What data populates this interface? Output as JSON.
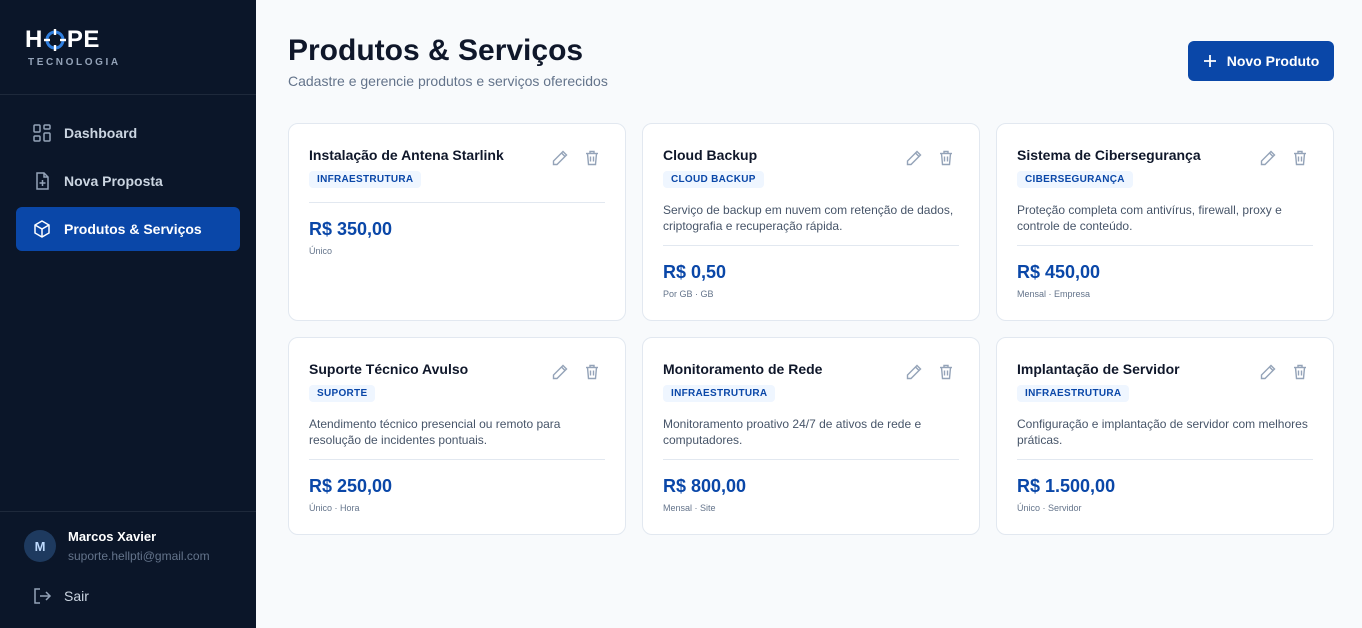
{
  "brand": {
    "name_left": "H",
    "name_right": "PE",
    "tagline": "TECNOLOGIA"
  },
  "nav": [
    {
      "label": "Dashboard",
      "icon": "grid-icon",
      "active": false
    },
    {
      "label": "Nova Proposta",
      "icon": "file-plus-icon",
      "active": false
    },
    {
      "label": "Produtos & Serviços",
      "icon": "box-icon",
      "active": true
    }
  ],
  "user": {
    "initial": "M",
    "name": "Marcos Xavier",
    "email": "suporte.hellpti@gmail.com"
  },
  "logout_label": "Sair",
  "header": {
    "title": "Produtos & Serviços",
    "subtitle": "Cadastre e gerencie produtos e serviços oferecidos",
    "new_button": "Novo Produto"
  },
  "colors": {
    "accent": "#0a47a8",
    "sidebar": "#0b1629",
    "badge_bg": "#eff6ff"
  },
  "products": [
    {
      "title": "Instalação de Antena Starlink",
      "category": "INFRAESTRUTURA",
      "description": "",
      "price": "R$ 350,00",
      "unit": "Único"
    },
    {
      "title": "Cloud Backup",
      "category": "CLOUD BACKUP",
      "description": "Serviço de backup em nuvem com retenção de dados, criptografia e recuperação rápida.",
      "price": "R$ 0,50",
      "unit": "Por GB · GB"
    },
    {
      "title": "Sistema de Cibersegurança",
      "category": "CIBERSEGURANÇA",
      "description": "Proteção completa com antivírus, firewall, proxy e controle de conteúdo.",
      "price": "R$ 450,00",
      "unit": "Mensal · Empresa"
    },
    {
      "title": "Suporte Técnico Avulso",
      "category": "SUPORTE",
      "description": "Atendimento técnico presencial ou remoto para resolução de incidentes pontuais.",
      "price": "R$ 250,00",
      "unit": "Único · Hora"
    },
    {
      "title": "Monitoramento de Rede",
      "category": "INFRAESTRUTURA",
      "description": "Monitoramento proativo 24/7 de ativos de rede e computadores.",
      "price": "R$ 800,00",
      "unit": "Mensal · Site"
    },
    {
      "title": "Implantação de Servidor",
      "category": "INFRAESTRUTURA",
      "description": "Configuração e implantação de servidor com melhores práticas.",
      "price": "R$ 1.500,00",
      "unit": "Único · Servidor"
    }
  ]
}
